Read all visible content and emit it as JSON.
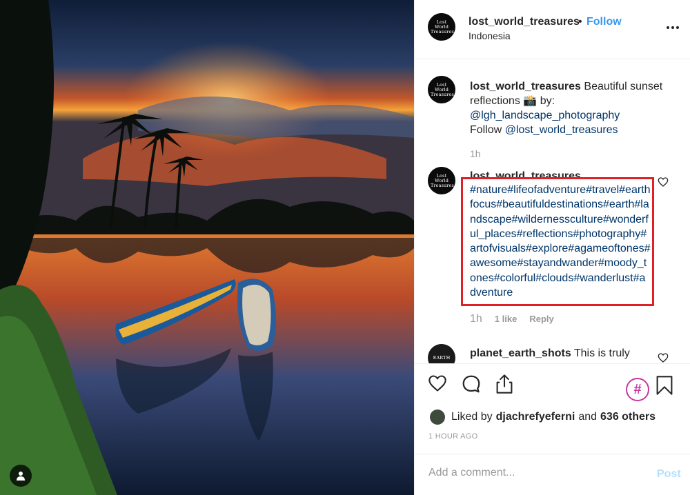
{
  "post": {
    "username": "lost_world_treasures",
    "follow_label": "Follow",
    "separator": "•",
    "location": "Indonesia",
    "avatar_text": "Lost World Treasures"
  },
  "caption": {
    "username": "lost_world_treasures",
    "text_part1": " Beautiful sunset reflections ",
    "emoji": "📸",
    "text_part2": " by:",
    "credit": "@lgh_landscape_photography",
    "follow_prefix": "Follow ",
    "follow_handle": "@lost_world_treasures",
    "time": "1h"
  },
  "hashtag_comment": {
    "username": "lost_world_treasures",
    "text": "#nature#lifeofadventure#travel#earthfocus#beautifuldestinations#earth#landscape#wildernessculture#wonderful_places#reflections#photography#artofvisuals#explore#agameoftones#awesome#stayandwander#moody_tones#colorful#clouds#wanderlust#adventure",
    "time": "1h",
    "likes": "1 like",
    "reply": "Reply"
  },
  "comment3": {
    "username": "planet_earth_shots",
    "text": " This is truly",
    "avatar_text": "EARTH"
  },
  "actions": {
    "hashtag_symbol": "#"
  },
  "likes": {
    "prefix": "Liked by",
    "user": "djachrefyeferni",
    "and": "and",
    "count": "636 others"
  },
  "post_time": "1 HOUR AGO",
  "comment_box": {
    "placeholder": "Add a comment...",
    "post_label": "Post"
  },
  "colors": {
    "link_blue": "#3897f0",
    "hashtag_navy": "#003569",
    "highlight_red": "#e01f26",
    "meta_gray": "#999999"
  }
}
